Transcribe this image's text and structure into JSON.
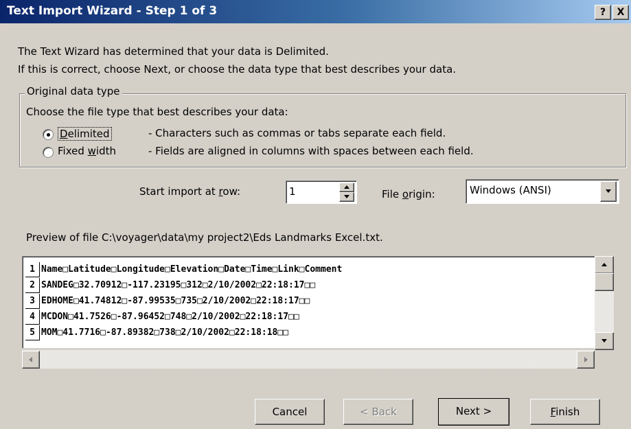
{
  "window": {
    "title": "Text Import Wizard - Step 1 of 3",
    "help_label": "?",
    "close_label": "X"
  },
  "intro": {
    "line1": "The Text Wizard has determined that your data is Delimited.",
    "line2": "If this is correct, choose Next, or choose the data type that best describes your data."
  },
  "group": {
    "legend": "Original data type",
    "prompt": "Choose the file type that best describes your data:",
    "options": [
      {
        "label_pre": "",
        "label_u": "D",
        "label_post": "elimited",
        "desc": "- Characters such as commas or tabs separate each field.",
        "selected": true
      },
      {
        "label_pre": "Fixed ",
        "label_u": "w",
        "label_post": "idth",
        "desc": "- Fields are aligned in columns with spaces between each field.",
        "selected": false
      }
    ]
  },
  "start_row": {
    "label_pre": "Start import at ",
    "label_u": "r",
    "label_post": "ow:",
    "value": "1"
  },
  "file_origin": {
    "label_pre": "File ",
    "label_u": "o",
    "label_post": "rigin:",
    "value": "Windows (ANSI)"
  },
  "preview": {
    "label": "Preview of file C:\\voyager\\data\\my project2\\Eds  Landmarks Excel.txt.",
    "rows": [
      {
        "num": "1",
        "text": "Name□Latitude□Longitude□Elevation□Date□Time□Link□Comment"
      },
      {
        "num": "2",
        "text": "SANDEG□32.70912□-117.23195□312□2/10/2002□22:18:17□□"
      },
      {
        "num": "3",
        "text": "EDHOME□41.74812□-87.99535□735□2/10/2002□22:18:17□□"
      },
      {
        "num": "4",
        "text": "MCDON□41.7526□-87.96452□748□2/10/2002□22:18:17□□"
      },
      {
        "num": "5",
        "text": "MOM□41.7716□-87.89382□738□2/10/2002□22:18:18□□"
      }
    ]
  },
  "buttons": {
    "cancel": "Cancel",
    "back": "< Back",
    "next": "Next >",
    "finish_u": "F",
    "finish_rest": "inish"
  },
  "colors": {
    "face": "#d4d0c8",
    "title_start": "#0a246a",
    "title_end": "#a6caf0"
  }
}
